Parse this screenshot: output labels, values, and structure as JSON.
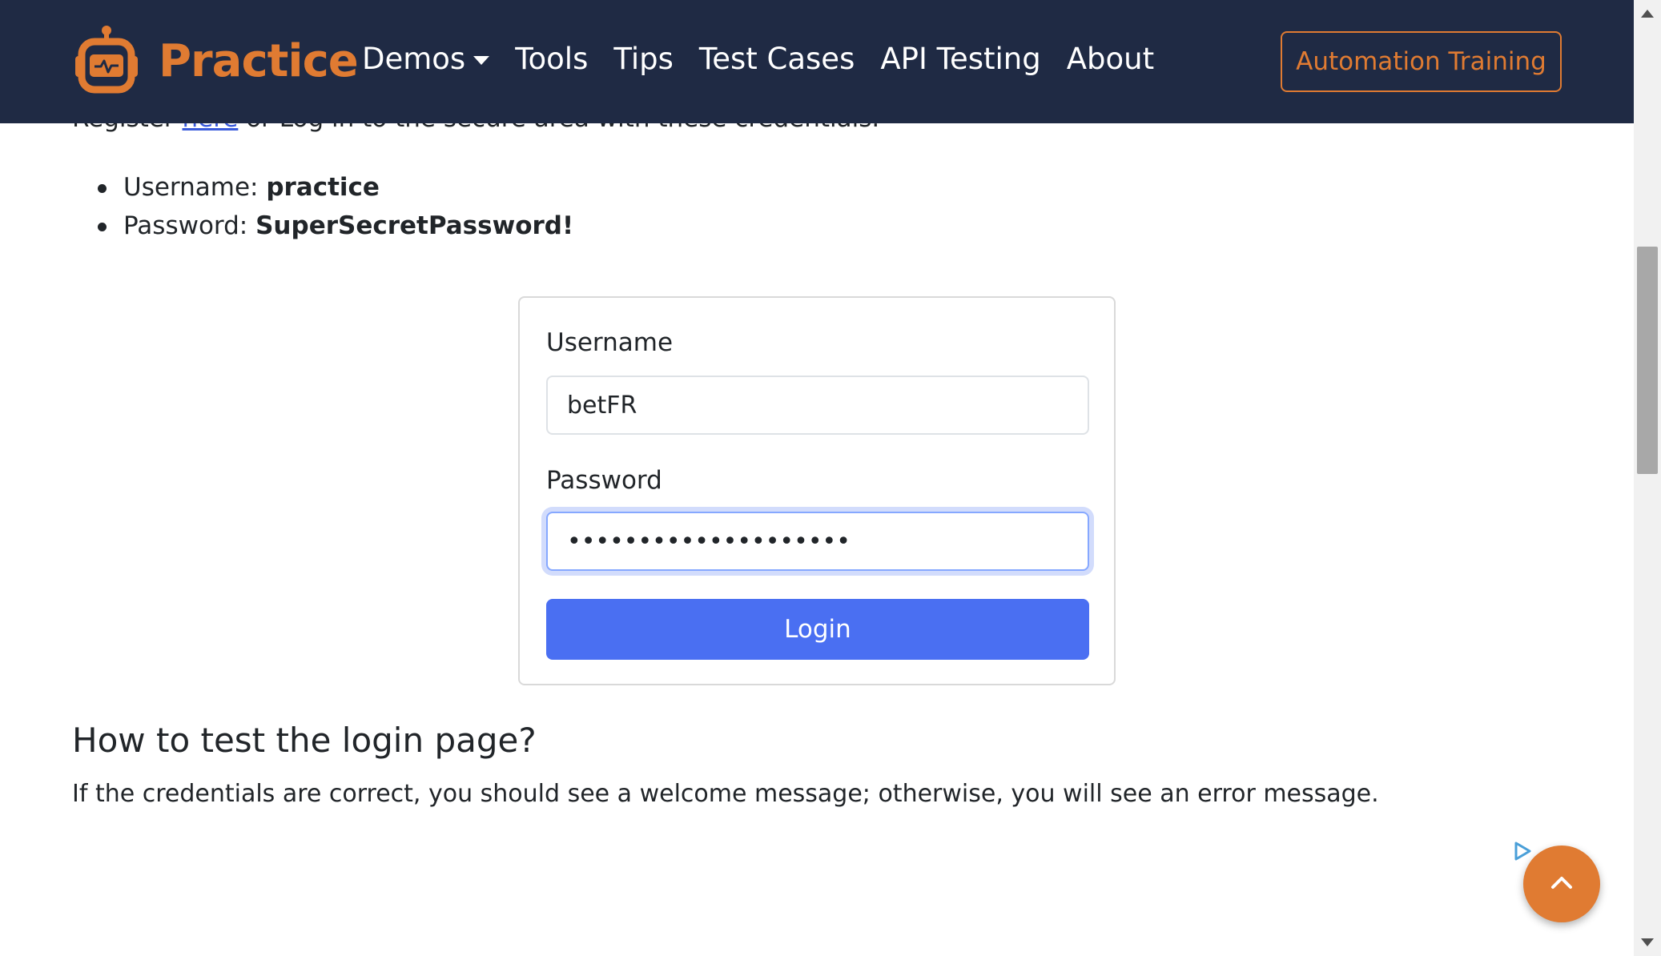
{
  "navbar": {
    "brand": "Practice",
    "links": [
      "Demos",
      "Tools",
      "Tips",
      "Test Cases",
      "API Testing",
      "About"
    ],
    "cta_label": "Automation Training"
  },
  "intro": {
    "prefix": "Register ",
    "link": "here",
    "suffix": " or Log in to the secure area with these credentials."
  },
  "credentials": {
    "username_label": "Username: ",
    "username_value": "practice",
    "password_label": "Password: ",
    "password_value": "SuperSecretPassword!"
  },
  "form": {
    "username_label": "Username",
    "username_value": "betFR",
    "password_label": "Password",
    "password_value": "••••••••••••••••••••",
    "login_label": "Login"
  },
  "section": {
    "title": "How to test the login page?",
    "text": "If the credentials are correct, you should see a welcome message; otherwise, you will see an error message."
  },
  "colors": {
    "navbar_bg": "#1f2a44",
    "accent_orange": "#e07b32",
    "button_blue": "#4a6ff2",
    "link_blue": "#3b5bdb"
  },
  "icons": {
    "brand": "robot-logo-icon",
    "back_to_top": "chevron-up-icon",
    "ad": "ad-choices-icon"
  }
}
